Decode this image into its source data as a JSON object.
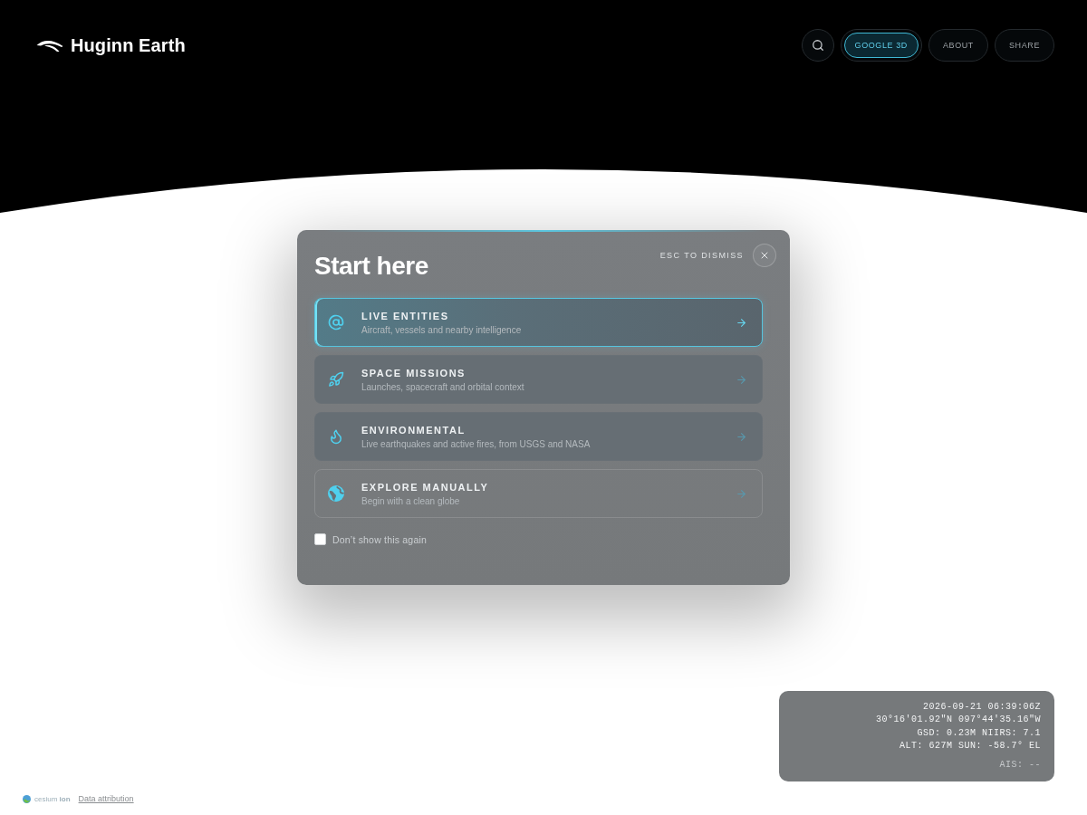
{
  "header": {
    "brand": "Huginn Earth",
    "nav_buttons": [
      {
        "label": "GOOGLE 3D",
        "on": true
      },
      {
        "label": "ABOUT",
        "on": false
      },
      {
        "label": "SHARE",
        "on": false
      }
    ]
  },
  "dialog": {
    "title": "Start here",
    "dismiss_hint": "ESC TO DISMISS",
    "options": [
      {
        "title": "LIVE ENTITIES",
        "subtitle": "Aircraft, vessels and nearby intelligence",
        "kind": "panel",
        "selected": true
      },
      {
        "title": "SPACE MISSIONS",
        "subtitle": "Launches, spacecraft and orbital context",
        "kind": "panel",
        "selected": false
      },
      {
        "title": "ENVIRONMENTAL",
        "subtitle": "Live earthquakes and active fires, from USGS and NASA",
        "kind": "panel",
        "selected": false
      },
      {
        "title": "EXPLORE MANUALLY",
        "subtitle": "Begin with a clean globe",
        "kind": "outline",
        "selected": false
      }
    ],
    "dont_show": {
      "label": "Don’t show this again",
      "checked": false
    }
  },
  "readout": {
    "lines": [
      "2026-09-21 06:39:06Z",
      "30°16'01.92\"N 097°44'35.16\"W",
      "GSD: 0.23M NIIRS: 7.1",
      "ALT: 627M SUN: -58.7° EL"
    ],
    "ais": "AIS: --"
  },
  "attribution": {
    "logo": "cesium **ion**",
    "link": "Data attribution"
  }
}
